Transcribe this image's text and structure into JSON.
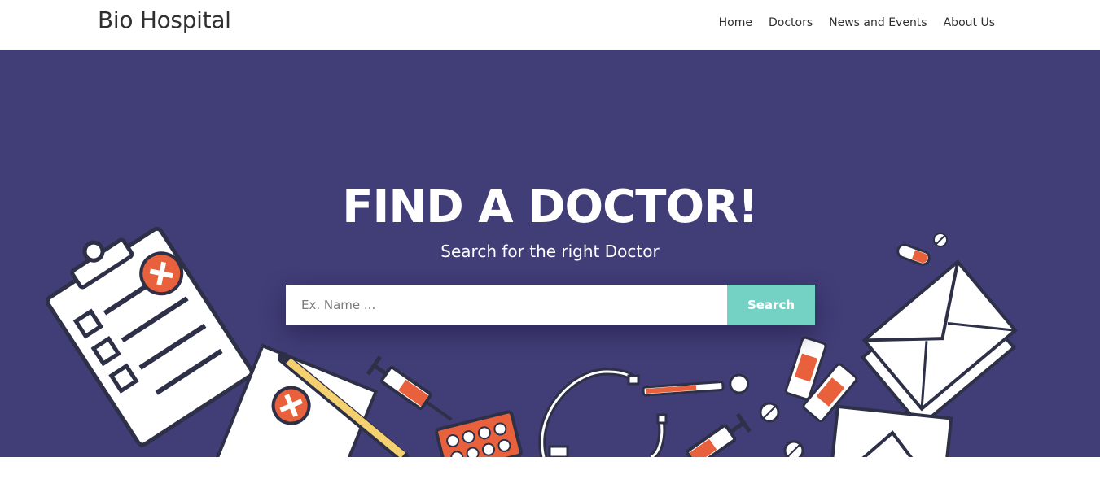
{
  "header": {
    "brand": "Bio Hospital",
    "nav": [
      {
        "label": "Home"
      },
      {
        "label": "Doctors"
      },
      {
        "label": "News and Events"
      },
      {
        "label": "About Us"
      }
    ]
  },
  "hero": {
    "title": "FIND A DOCTOR!",
    "subtitle": "Search for the right Doctor",
    "search": {
      "placeholder": "Ex. Name ...",
      "value": "",
      "button_label": "Search"
    },
    "illustration_icons": [
      "clipboard-icon",
      "notepad-icon",
      "pencil-icon",
      "syringe-icon",
      "pill-blister-icon",
      "stethoscope-icon",
      "thermometer-icon",
      "bandage-icon",
      "envelope-icon",
      "capsule-icon",
      "pill-icon"
    ]
  },
  "colors": {
    "hero_bg": "#413d77",
    "accent": "#74d2c5",
    "medical_orange": "#e8613c",
    "outline": "#2d3047"
  }
}
